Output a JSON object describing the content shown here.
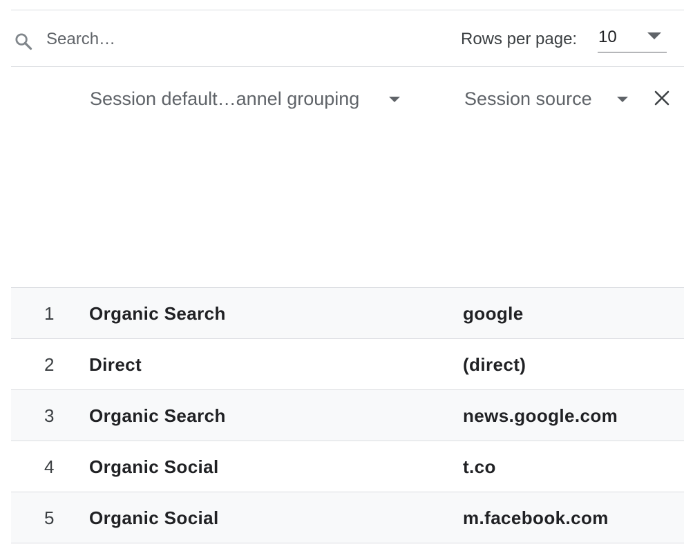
{
  "toolbar": {
    "search_placeholder": "Search…",
    "rows_per_page_label": "Rows per page:",
    "rows_per_page_value": "10"
  },
  "columns": {
    "dimension1": "Session default…annel grouping",
    "dimension2": "Session source"
  },
  "rows": [
    {
      "index": "1",
      "channel": "Organic Search",
      "source": "google"
    },
    {
      "index": "2",
      "channel": "Direct",
      "source": "(direct)"
    },
    {
      "index": "3",
      "channel": "Organic Search",
      "source": "news.google.com"
    },
    {
      "index": "4",
      "channel": "Organic Social",
      "source": "t.co"
    },
    {
      "index": "5",
      "channel": "Organic Social",
      "source": "m.facebook.com"
    }
  ],
  "icons": {
    "search": "search-icon",
    "dropdown": "arrow-drop-down-icon",
    "close": "close-icon"
  },
  "colors": {
    "divider": "#dadce0",
    "shaded_row": "#f8f9fa",
    "muted_text": "#5f6368",
    "text": "#202124"
  }
}
